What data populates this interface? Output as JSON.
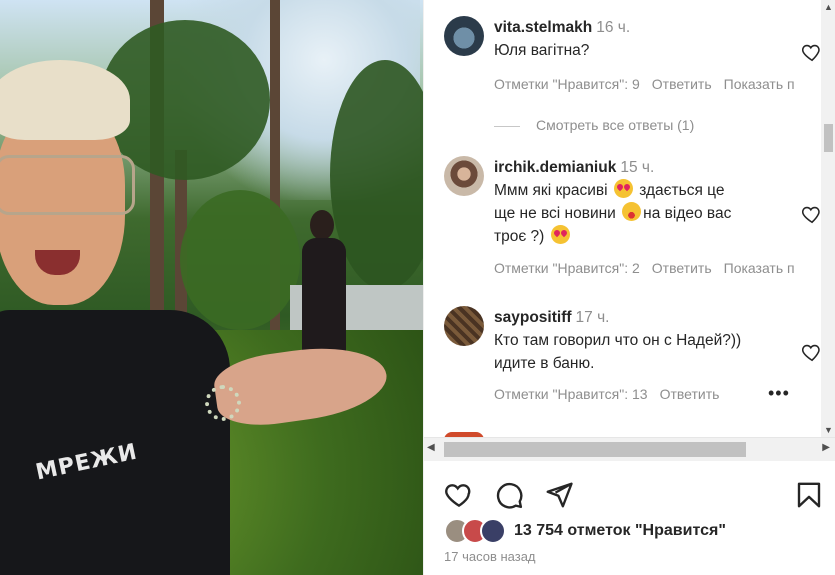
{
  "media": {
    "shirt_print": "МРЕЖИ"
  },
  "comments": [
    {
      "username": "vita.stelmakh",
      "time": "16 ч.",
      "text": "Юля вагітна?",
      "likes": "Отметки \"Нравится\": 9",
      "reply": "Ответить",
      "translate": "Показать п"
    },
    {
      "username": "irchik.demianiuk",
      "time": "15 ч.",
      "text_1": "Ммм які красиві",
      "text_2": "здається це",
      "text_3": "ще не всі новини",
      "text_4": "на відео вас",
      "text_5": "троє ?)",
      "likes": "Отметки \"Нравится\": 2",
      "reply": "Ответить",
      "translate": "Показать п"
    },
    {
      "username": "saypositiff",
      "time": "17 ч.",
      "text_1": "Кто там говорил что он с Надей?))",
      "text_2": "идите в баню.",
      "likes": "Отметки \"Нравится\": 13",
      "reply": "Ответить",
      "more": "•••"
    }
  ],
  "view_replies": "Смотреть все ответы (1)",
  "like_count": "13 754 отметок \"Нравится\"",
  "posted_ago": "17 часов назад",
  "icons": [
    "heart-icon",
    "comment-icon",
    "share-icon",
    "bookmark-icon"
  ]
}
